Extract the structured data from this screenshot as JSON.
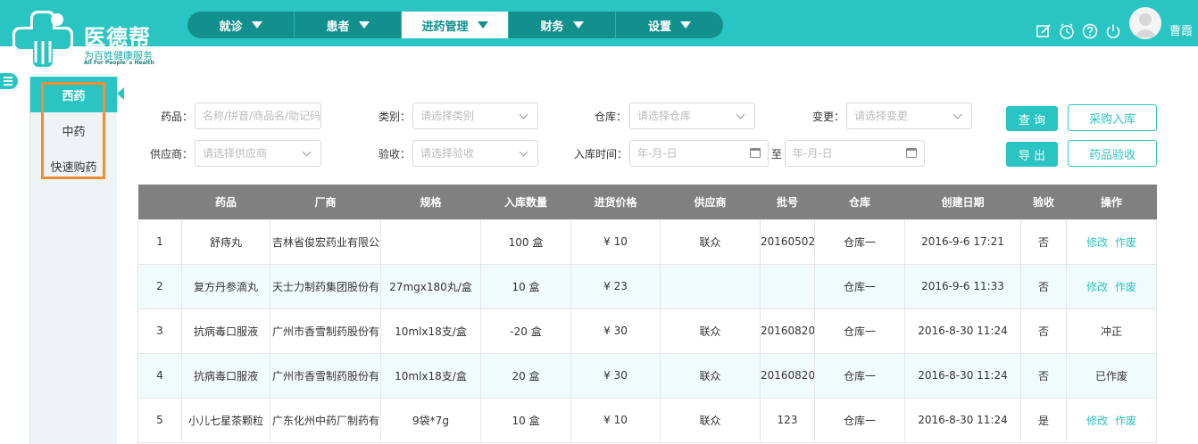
{
  "brand": {
    "name": "医德帮",
    "tagline": "为百姓健康服务",
    "tagline_en": "All For People' s Health",
    "color": "#2ac5c3"
  },
  "nav": [
    {
      "label": "就诊"
    },
    {
      "label": "患者"
    },
    {
      "label": "进药管理",
      "active": true
    },
    {
      "label": "财务"
    },
    {
      "label": "设置"
    }
  ],
  "header_icons": [
    "edit-icon",
    "clock-icon",
    "help-icon",
    "power-icon"
  ],
  "user": {
    "name": "曹霞"
  },
  "sidebar": [
    {
      "label": "西药",
      "active": true
    },
    {
      "label": "中药"
    },
    {
      "label": "快速购药"
    }
  ],
  "filters": {
    "drug_label": "药品：",
    "drug_placeholder": "名称/拼音/商品名/助记码",
    "category_label": "类别：",
    "category_placeholder": "请选择类别",
    "warehouse_label": "仓库：",
    "warehouse_placeholder": "请选择仓库",
    "change_label": "变更：",
    "change_placeholder": "请选择变更",
    "supplier_label": "供应商：",
    "supplier_placeholder": "请选择供应商",
    "inspect_label": "验收：",
    "inspect_placeholder": "请选择验收",
    "date_label": "入库时间：",
    "date_from_placeholder": "年-月-日",
    "date_to_label": "至",
    "date_to_placeholder": "年-月-日"
  },
  "buttons": {
    "query": "查 询",
    "purchase": "采购入库",
    "export": "导 出",
    "inspect": "药品验收"
  },
  "table": {
    "headers": [
      "",
      "药品",
      "厂商",
      "规格",
      "入库数量",
      "进货价格",
      "供应商",
      "批号",
      "仓库",
      "创建日期",
      "验收",
      "操作"
    ],
    "rows": [
      {
        "no": "1",
        "drug": "舒痔丸",
        "maker": "吉林省俊宏药业有限公",
        "spec": "",
        "qty": "100 盒",
        "price": "¥ 10",
        "supplier": "联众",
        "batch": "20160502",
        "warehouse": "仓库一",
        "date": "2016-9-6 17:21",
        "checked": "否",
        "actions": [
          "修改",
          "作废"
        ],
        "status": ""
      },
      {
        "no": "2",
        "drug": "复方丹参滴丸",
        "maker": "天士力制药集团股份有",
        "spec": "27mgx180丸/盒",
        "qty": "10 盒",
        "price": "¥ 23",
        "supplier": "",
        "batch": "",
        "warehouse": "仓库一",
        "date": "2016-9-6 11:33",
        "checked": "否",
        "actions": [
          "修改",
          "作废"
        ],
        "status": ""
      },
      {
        "no": "3",
        "drug": "抗病毒口服液",
        "maker": "广州市香雪制药股份有",
        "spec": "10mlx18支/盒",
        "qty": "-20 盒",
        "price": "¥ 30",
        "supplier": "联众",
        "batch": "20160820",
        "warehouse": "仓库一",
        "date": "2016-8-30 11:24",
        "checked": "否",
        "actions": [],
        "status": "冲正"
      },
      {
        "no": "4",
        "drug": "抗病毒口服液",
        "maker": "广州市香雪制药股份有",
        "spec": "10mlx18支/盒",
        "qty": "20 盒",
        "price": "¥ 30",
        "supplier": "联众",
        "batch": "20160820",
        "warehouse": "仓库一",
        "date": "2016-8-30 11:24",
        "checked": "否",
        "actions": [],
        "status": "已作废"
      },
      {
        "no": "5",
        "drug": "小儿七星茶颗粒",
        "maker": "广东化州中药厂制药有",
        "spec": "9袋*7g",
        "qty": "10 盒",
        "price": "¥ 10",
        "supplier": "联众",
        "batch": "123",
        "warehouse": "仓库一",
        "date": "2016-8-30 11:24",
        "checked": "是",
        "actions": [
          "修改",
          "作废"
        ],
        "status": ""
      }
    ]
  }
}
